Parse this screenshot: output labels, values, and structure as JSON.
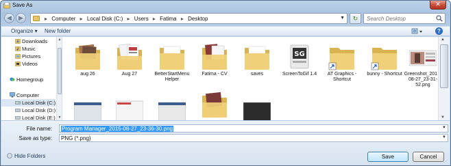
{
  "window": {
    "title": "Save As",
    "close_label": "✕"
  },
  "address": {
    "crumbs": [
      "Computer",
      "Local Disk (C:)",
      "Users",
      "Fatima",
      "Desktop"
    ],
    "search_placeholder": "Search Desktop"
  },
  "toolbar": {
    "organize": "Organize ▾",
    "new_folder": "New folder",
    "help": "?"
  },
  "nav": {
    "items": [
      {
        "label": "Downloads",
        "icon": "downloads-icon"
      },
      {
        "label": "Music",
        "icon": "music-icon"
      },
      {
        "label": "Pictures",
        "icon": "pictures-icon"
      },
      {
        "label": "Videos",
        "icon": "videos-icon"
      },
      {
        "label": "Homegroup",
        "icon": "homegroup-icon"
      },
      {
        "label": "Computer",
        "icon": "computer-icon"
      },
      {
        "label": "Local Disk (C:)",
        "icon": "drive-icon"
      },
      {
        "label": "Local Disk (D:)",
        "icon": "drive-icon"
      },
      {
        "label": "Local Disk (E:)",
        "icon": "drive-icon"
      }
    ]
  },
  "files": [
    {
      "label": "aug 26",
      "type": "folder-photos"
    },
    {
      "label": "Aug 27",
      "type": "folder-docs"
    },
    {
      "label": "BetterStartMenu Helper",
      "type": "folder"
    },
    {
      "label": "Fatima - CV",
      "type": "folder-photos"
    },
    {
      "label": "saves",
      "type": "folder"
    },
    {
      "label": "ScreenToGif 1.4",
      "type": "app-sg"
    },
    {
      "label": "AT Graphics - Shortcut",
      "type": "folder-shortcut"
    },
    {
      "label": "bunny - Shortcut",
      "type": "folder-shortcut"
    },
    {
      "label": "Greenshot_2015-08-27_23-31-52.png",
      "type": "image"
    }
  ],
  "form": {
    "filename_label": "File name:",
    "filename_value": "Program Manager_2015-08-27_23-36-30.png",
    "savetype_label": "Save as type:",
    "savetype_value": "PNG (*.png)"
  },
  "buttons": {
    "hide_folders": "Hide Folders",
    "save": "Save",
    "cancel": "Cancel"
  },
  "colors": {
    "accent": "#3399ff",
    "folder": "#e8c569",
    "titlebar": "#bcd3ea"
  }
}
